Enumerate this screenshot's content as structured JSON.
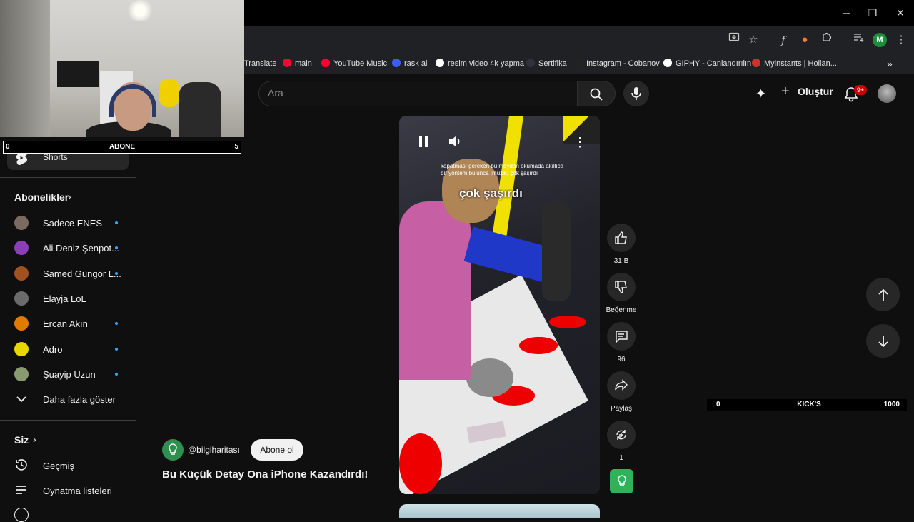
{
  "browser": {
    "window_controls": [
      "─",
      "❐",
      "✕"
    ],
    "profile_initial": "M",
    "bookmarks": [
      {
        "label": "Translate",
        "color": "#3c7de4"
      },
      {
        "label": "main",
        "color": "#ff0033"
      },
      {
        "label": "YouTube Music",
        "color": "#ff0033"
      },
      {
        "label": "rask ai",
        "color": "#3b5bff"
      },
      {
        "label": "resim video 4k yapma",
        "color": "#ffffff"
      },
      {
        "label": "Sertifika",
        "color": "#303040"
      },
      {
        "label": "Instagram - Cobanov",
        "color": "#222222"
      },
      {
        "label": "GIPHY - Canlandırılın",
        "color": "#ffffff"
      },
      {
        "label": "Myinstants | Hollan...",
        "color": "#d32f2f"
      }
    ],
    "more_bookmarks": "»"
  },
  "header": {
    "search_placeholder": "Ara",
    "create_label": "Oluştur",
    "notif_count": "9+"
  },
  "overlay": {
    "abone_bar": {
      "left": "0",
      "label": "ABONE",
      "right": "5"
    },
    "kick_bar": {
      "left": "0",
      "label": "KICK'S",
      "right": "1000"
    }
  },
  "sidebar": {
    "shorts_label": "Shorts",
    "subscriptions_title": "Abonelikler",
    "channels": [
      {
        "name": "Sadece ENES",
        "color": "#7b6a60",
        "dot": true
      },
      {
        "name": "Ali Deniz Şenpot...",
        "color": "#8a3fb5",
        "dot": true
      },
      {
        "name": "Samed Güngör L...",
        "color": "#a0521e",
        "dot": true
      },
      {
        "name": "Elayja LoL",
        "color": "#6b6b6b",
        "dot": false
      },
      {
        "name": "Ercan Akın",
        "color": "#e07b00",
        "dot": true
      },
      {
        "name": "Adro",
        "color": "#e8d800",
        "dot": true
      },
      {
        "name": "Şuayip Uzun",
        "color": "#8a9a70",
        "dot": true
      }
    ],
    "show_more": "Daha fazla göster",
    "you_title": "Siz",
    "you_items": [
      "Geçmiş",
      "Oynatma listeleri"
    ]
  },
  "short": {
    "caption_small": "kapatması gereken bu meydan okumada akıllıca bir yöntem bulunca [müzik] çok şaşırdı",
    "caption_big_1": "çok",
    "caption_big_2": "şaşırdı",
    "channel_handle": "@bilgiharitası",
    "subscribe_label": "Abone ol",
    "title": "Bu Küçük Detay Ona iPhone Kazandırdı!",
    "like_count": "31 B",
    "dislike_label": "Beğenme",
    "comment_count": "96",
    "share_label": "Paylaş",
    "remix_count": "1"
  }
}
